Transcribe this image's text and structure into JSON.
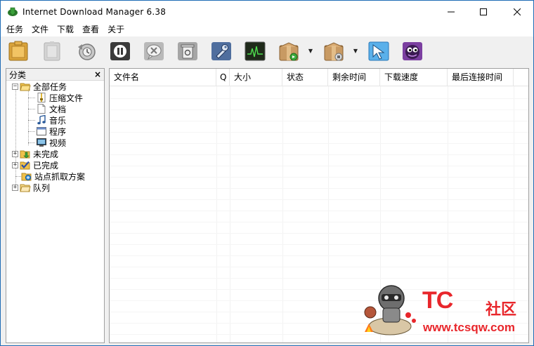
{
  "window": {
    "title": "Internet Download Manager 6.38"
  },
  "menu": [
    "任务",
    "文件",
    "下载",
    "查看",
    "关于"
  ],
  "toolbar": {
    "buttons": [
      {
        "name": "new-task-icon",
        "color": "#d9a33a"
      },
      {
        "name": "resume-icon",
        "color": "#c8c8c8"
      },
      {
        "name": "stop-icon",
        "color": "#8f8f8f"
      },
      {
        "name": "stop-all-icon",
        "color": "#3a3a3a"
      },
      {
        "name": "delete-icon",
        "color": "#9a9a9a"
      },
      {
        "name": "delete-all-icon",
        "color": "#8e8e8e"
      },
      {
        "name": "options-icon",
        "color": "#5a78a8"
      },
      {
        "name": "scheduler-icon",
        "color": "#2f3a2a"
      },
      {
        "name": "start-queue-icon",
        "color": "#b48a55"
      },
      {
        "name": "stop-queue-icon",
        "color": "#b48a55"
      },
      {
        "name": "grabber-icon",
        "color": "#4ea3e0"
      },
      {
        "name": "tell-friend-icon",
        "color": "#6a3a8a"
      }
    ]
  },
  "categories": {
    "title": "分类",
    "close": "×",
    "tree": [
      {
        "label": "全部任务",
        "icon": "folder-open-icon",
        "expander": "−"
      },
      {
        "label": "压缩文件",
        "icon": "archive-icon"
      },
      {
        "label": "文档",
        "icon": "document-icon"
      },
      {
        "label": "音乐",
        "icon": "music-icon"
      },
      {
        "label": "程序",
        "icon": "program-icon"
      },
      {
        "label": "视频",
        "icon": "video-icon"
      },
      {
        "label": "未完成",
        "icon": "unfinished-folder-icon",
        "expander": "+"
      },
      {
        "label": "已完成",
        "icon": "finished-folder-icon",
        "expander": "+"
      },
      {
        "label": "站点抓取方案",
        "icon": "grabber-project-icon"
      },
      {
        "label": "队列",
        "icon": "queue-folder-icon",
        "expander": "+"
      }
    ]
  },
  "downloads": {
    "columns": [
      "文件名",
      "Q",
      "大小",
      "状态",
      "剩余时间",
      "下载速度",
      "最后连接时间"
    ],
    "rows": []
  },
  "watermark": {
    "brand": "TC",
    "suffix": "社区",
    "url": "www.tcsqw.com"
  },
  "colors": {
    "accent": "#1f6cb5",
    "watermark": "#e8262b"
  }
}
